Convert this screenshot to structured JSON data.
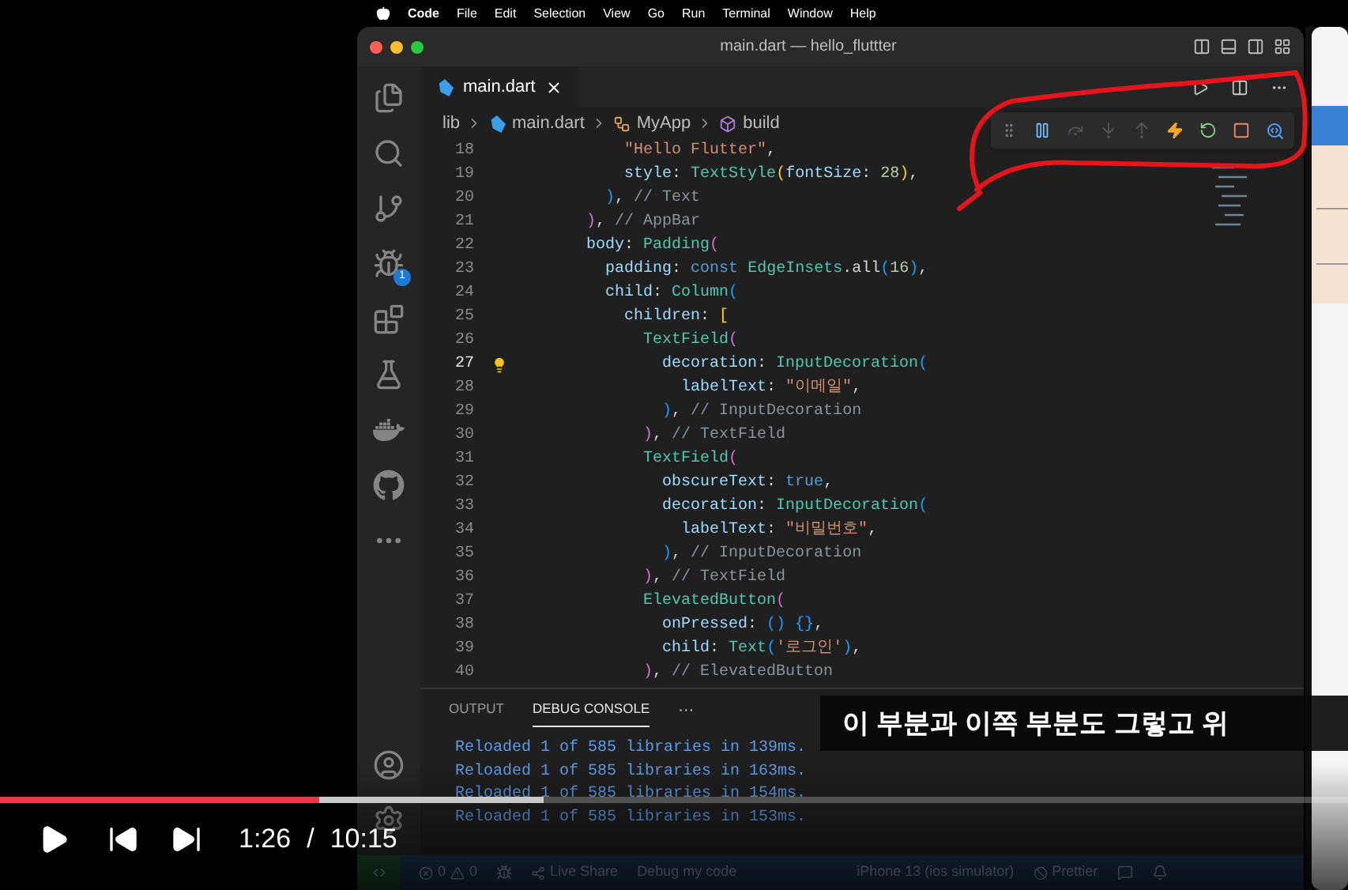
{
  "menu_bar": {
    "app": "Code",
    "items": [
      "File",
      "Edit",
      "Selection",
      "View",
      "Go",
      "Run",
      "Terminal",
      "Window",
      "Help"
    ]
  },
  "window": {
    "title": "main.dart — hello_fluttter"
  },
  "activity_bar": {
    "debug_badge": "1"
  },
  "editor_tabs": [
    {
      "label": "main.dart",
      "selected": true
    }
  ],
  "breadcrumb": [
    {
      "kind": "folder",
      "label": "lib"
    },
    {
      "kind": "file",
      "label": "main.dart"
    },
    {
      "kind": "class",
      "label": "MyApp"
    },
    {
      "kind": "method",
      "label": "build"
    }
  ],
  "code_lines": [
    {
      "n": "18",
      "active": false,
      "code": [
        {
          "kind": "str",
          "text": "            \"Hello Flutter\""
        },
        {
          "kind": "p",
          "text": ","
        }
      ]
    },
    {
      "n": "19",
      "active": false,
      "code": [
        {
          "kind": "key",
          "text": "            style"
        },
        {
          "kind": "p",
          "text": ": "
        },
        {
          "kind": "cls",
          "text": "TextStyle"
        },
        {
          "kind": "br3",
          "text": "("
        },
        {
          "kind": "key",
          "text": "fontSize"
        },
        {
          "kind": "p",
          "text": ": "
        },
        {
          "kind": "num",
          "text": "28"
        },
        {
          "kind": "br3",
          "text": ")"
        },
        {
          "kind": "p",
          "text": ","
        }
      ]
    },
    {
      "n": "20",
      "active": false,
      "code": [
        {
          "kind": "br2",
          "text": "          )"
        },
        {
          "kind": "p",
          "text": ", "
        },
        {
          "kind": "com",
          "text": "// Text"
        }
      ]
    },
    {
      "n": "21",
      "active": false,
      "code": [
        {
          "kind": "br1",
          "text": "        )"
        },
        {
          "kind": "p",
          "text": ", "
        },
        {
          "kind": "com",
          "text": "// AppBar"
        }
      ]
    },
    {
      "n": "22",
      "active": false,
      "code": [
        {
          "kind": "key",
          "text": "        body"
        },
        {
          "kind": "p",
          "text": ": "
        },
        {
          "kind": "cls",
          "text": "Padding"
        },
        {
          "kind": "br1",
          "text": "("
        }
      ]
    },
    {
      "n": "23",
      "active": false,
      "code": [
        {
          "kind": "key",
          "text": "          padding"
        },
        {
          "kind": "p",
          "text": ": "
        },
        {
          "kind": "kw",
          "text": "const "
        },
        {
          "kind": "cls",
          "text": "EdgeInsets"
        },
        {
          "kind": "p",
          "text": ".all"
        },
        {
          "kind": "br2",
          "text": "("
        },
        {
          "kind": "num",
          "text": "16"
        },
        {
          "kind": "br2",
          "text": ")"
        },
        {
          "kind": "p",
          "text": ","
        }
      ]
    },
    {
      "n": "24",
      "active": false,
      "code": [
        {
          "kind": "key",
          "text": "          child"
        },
        {
          "kind": "p",
          "text": ": "
        },
        {
          "kind": "cls",
          "text": "Column"
        },
        {
          "kind": "br2",
          "text": "("
        }
      ]
    },
    {
      "n": "25",
      "active": false,
      "code": [
        {
          "kind": "key",
          "text": "            children"
        },
        {
          "kind": "p",
          "text": ": "
        },
        {
          "kind": "br3",
          "text": "["
        }
      ]
    },
    {
      "n": "26",
      "active": false,
      "code": [
        {
          "kind": "cls",
          "text": "              TextField"
        },
        {
          "kind": "br1",
          "text": "("
        }
      ]
    },
    {
      "n": "27",
      "active": true,
      "code": [
        {
          "kind": "key",
          "text": "                decoration"
        },
        {
          "kind": "p",
          "text": ": "
        },
        {
          "kind": "cls",
          "text": "InputDecoration"
        },
        {
          "kind": "br2",
          "text": "("
        }
      ]
    },
    {
      "n": "28",
      "active": false,
      "code": [
        {
          "kind": "key",
          "text": "                  labelText"
        },
        {
          "kind": "p",
          "text": ": "
        },
        {
          "kind": "str",
          "text": "\"이메일\""
        },
        {
          "kind": "p",
          "text": ","
        }
      ]
    },
    {
      "n": "29",
      "active": false,
      "code": [
        {
          "kind": "br2",
          "text": "                )"
        },
        {
          "kind": "p",
          "text": ", "
        },
        {
          "kind": "com",
          "text": "// InputDecoration"
        }
      ]
    },
    {
      "n": "30",
      "active": false,
      "code": [
        {
          "kind": "br1",
          "text": "              )"
        },
        {
          "kind": "p",
          "text": ", "
        },
        {
          "kind": "com",
          "text": "// TextField"
        }
      ]
    },
    {
      "n": "31",
      "active": false,
      "code": [
        {
          "kind": "cls",
          "text": "              TextField"
        },
        {
          "kind": "br1",
          "text": "("
        }
      ]
    },
    {
      "n": "32",
      "active": false,
      "code": [
        {
          "kind": "key",
          "text": "                obscureText"
        },
        {
          "kind": "p",
          "text": ": "
        },
        {
          "kind": "kw",
          "text": "true"
        },
        {
          "kind": "p",
          "text": ","
        }
      ]
    },
    {
      "n": "33",
      "active": false,
      "code": [
        {
          "kind": "key",
          "text": "                decoration"
        },
        {
          "kind": "p",
          "text": ": "
        },
        {
          "kind": "cls",
          "text": "InputDecoration"
        },
        {
          "kind": "br2",
          "text": "("
        }
      ]
    },
    {
      "n": "34",
      "active": false,
      "code": [
        {
          "kind": "key",
          "text": "                  labelText"
        },
        {
          "kind": "p",
          "text": ": "
        },
        {
          "kind": "str",
          "text": "\"비밀번호\""
        },
        {
          "kind": "p",
          "text": ","
        }
      ]
    },
    {
      "n": "35",
      "active": false,
      "code": [
        {
          "kind": "br2",
          "text": "                )"
        },
        {
          "kind": "p",
          "text": ", "
        },
        {
          "kind": "com",
          "text": "// InputDecoration"
        }
      ]
    },
    {
      "n": "36",
      "active": false,
      "code": [
        {
          "kind": "br1",
          "text": "              )"
        },
        {
          "kind": "p",
          "text": ", "
        },
        {
          "kind": "com",
          "text": "// TextField"
        }
      ]
    },
    {
      "n": "37",
      "active": false,
      "code": [
        {
          "kind": "cls",
          "text": "              ElevatedButton"
        },
        {
          "kind": "br1",
          "text": "("
        }
      ]
    },
    {
      "n": "38",
      "active": false,
      "code": [
        {
          "kind": "key",
          "text": "                onPressed"
        },
        {
          "kind": "p",
          "text": ": "
        },
        {
          "kind": "br2",
          "text": "() {}"
        },
        {
          "kind": "p",
          "text": ","
        }
      ]
    },
    {
      "n": "39",
      "active": false,
      "code": [
        {
          "kind": "key",
          "text": "                child"
        },
        {
          "kind": "p",
          "text": ": "
        },
        {
          "kind": "cls",
          "text": "Text"
        },
        {
          "kind": "br2",
          "text": "("
        },
        {
          "kind": "str",
          "text": "'로그인'"
        },
        {
          "kind": "br2",
          "text": ")"
        },
        {
          "kind": "p",
          "text": ","
        }
      ]
    },
    {
      "n": "40",
      "active": false,
      "code": [
        {
          "kind": "br1",
          "text": "              )"
        },
        {
          "kind": "p",
          "text": ", "
        },
        {
          "kind": "com",
          "text": "// ElevatedButton"
        }
      ]
    }
  ],
  "panel": {
    "tabs": [
      {
        "label": "OUTPUT",
        "selected": false
      },
      {
        "label": "DEBUG CONSOLE",
        "selected": true
      }
    ],
    "more": "···",
    "console": [
      "Reloaded 1 of 585 libraries in 139ms.",
      "Reloaded 1 of 585 libraries in 163ms.",
      "Reloaded 1 of 585 libraries in 154ms.",
      "Reloaded 1 of 585 libraries in 153ms."
    ]
  },
  "status_bar": {
    "errors": "0",
    "warnings": "0",
    "items": [
      {
        "kind": "liveshare",
        "label": "Live Share"
      },
      {
        "kind": "text",
        "label": "Debug my code"
      },
      {
        "kind": "text",
        "label": "iPhone 13 (ios simulator)"
      },
      {
        "kind": "prettier",
        "label": "Prettier"
      }
    ]
  },
  "subtitle": "이 부분과 이쪽 부분도 그렇고 위",
  "player": {
    "played": {
      "level": 0.237
    },
    "buffered": {
      "level": 0.403
    },
    "current_time": "1:26",
    "separator": "/",
    "duration": "10:15"
  }
}
